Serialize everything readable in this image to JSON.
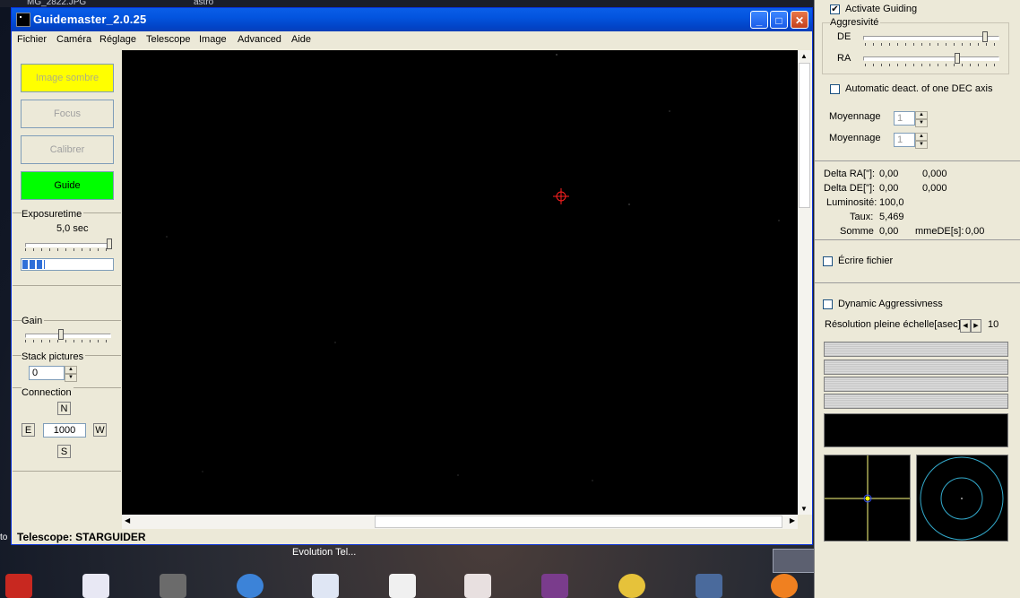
{
  "desktop": {
    "top_items": [
      "MG_2822.JPG",
      "astro"
    ],
    "caption": "Evolution Tel...",
    "edge_label": "to",
    "taskbar_icons": [
      "sw-icon",
      "notepad-icon",
      "program-icon",
      "ie-icon",
      "window-icon",
      "music-icon",
      "acrobat-icon",
      "winrar-icon",
      "app-icon",
      "film-icon",
      "avast-icon"
    ]
  },
  "window": {
    "title": "Guidemaster_2.0.25",
    "controls": {
      "minimize": "_",
      "maximize": "□",
      "close": "✕"
    },
    "menu": [
      "Fichier",
      "Caméra",
      "Réglage",
      "Telescope",
      "Image",
      "Advanced",
      "Aide"
    ],
    "buttons": {
      "dark": "Image sombre",
      "focus": "Focus",
      "calibrate": "Calibrer",
      "guide": "Guide"
    },
    "colors": {
      "dark_button": "#ffff00",
      "guide_button": "#00ff00",
      "crosshair": "#ff2020",
      "titlebar": "#0354de"
    },
    "exposure": {
      "label": "Exposuretime",
      "value": "5,0 sec",
      "progress_fraction": 0.25
    },
    "gain": {
      "label": "Gain"
    },
    "stack": {
      "label": "Stack pictures",
      "value": "0"
    },
    "connection": {
      "label": "Connection",
      "north": "N",
      "east": "E",
      "west": "W",
      "south": "S",
      "step": "1000"
    },
    "status": "Telescope: STARGUIDER"
  },
  "right": {
    "activate": {
      "label": "Activate Guiding",
      "checked": true
    },
    "aggr": {
      "label": "Aggresivité",
      "de": "DE",
      "ra": "RA"
    },
    "auto_deact": {
      "label": "Automatic deact. of one DEC axis",
      "checked": false
    },
    "moy1": {
      "label": "Moyennage",
      "value": "1"
    },
    "moy2": {
      "label": "Moyennage",
      "value": "1"
    },
    "stats": {
      "delta_ra_label": "Delta RA[\"]:",
      "delta_ra_1": "0,00",
      "delta_ra_2": "0,000",
      "delta_de_label": "Delta DE[\"]:",
      "delta_de_1": "0,00",
      "delta_de_2": "0,000",
      "lum_label": "Luminosité:",
      "lum": "100,0",
      "taux_label": "Taux:",
      "taux": "5,469",
      "somme_label": "Somme",
      "somme": "0,00",
      "mmede_label": "mmeDE[s]:",
      "mmede": "0,00"
    },
    "ecrire": {
      "label": "Écrire fichier",
      "checked": false
    },
    "dynamic": {
      "label": "Dynamic Aggressivness",
      "checked": false
    },
    "resolution": {
      "label": "Résolution pleine échelle[asec]:",
      "value": "10"
    }
  }
}
